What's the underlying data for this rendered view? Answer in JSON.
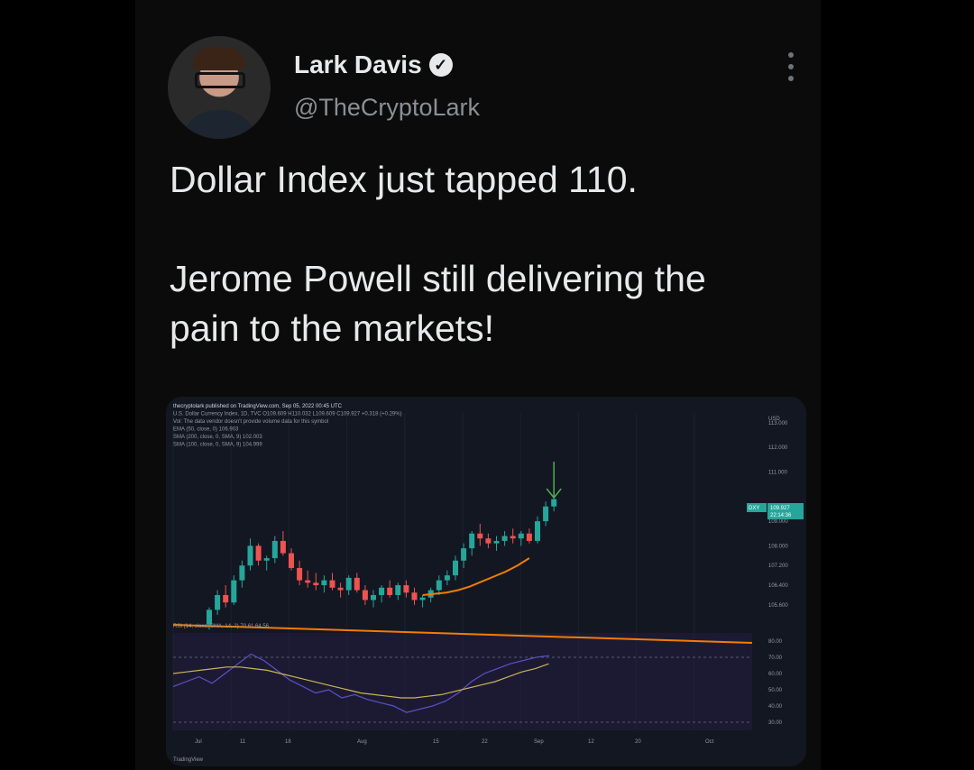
{
  "tweet": {
    "name": "Lark Davis",
    "handle": "@TheCryptoLark",
    "text": "Dollar Index just tapped 110.\n\nJerome Powell still delivering the\npain to the markets!"
  },
  "chart": {
    "publisher_line": "thecryptolark published on TradingView.com, Sep 05, 2022 00:45 UTC",
    "symbol_line": "U.S. Dollar Currency Index, 1D, TVC O109.609 H110.032 L109.609 C109.927 +0.318 (+0.29%)",
    "vol_line": "Vol: The data vendor doesn't provide volume data for this symbol",
    "ema_line": "EMA (50, close, 0) 106.903",
    "sma200_line": "SMA (200, close, 0, SMA, 9) 102.003",
    "sma100_line": "SMA (100, close, 0, SMA, 9) 104.999",
    "rsi_line": "RSI (14, close, SMA, 14, 2) 70.61 64.56",
    "currency": "USD",
    "price_badge_symbol": "DXY",
    "price_badge_value": "109.927",
    "price_badge_time": "22:14:36",
    "footer": "TradingView",
    "price_ticks": [
      "113.000",
      "112.000",
      "111.000",
      "109.000",
      "108.000",
      "107.200",
      "106.400",
      "105.600"
    ],
    "rsi_ticks": [
      "80.00",
      "70.00",
      "60.00",
      "50.00",
      "40.00",
      "30.00"
    ],
    "x_ticks": [
      "Jul",
      "11",
      "18",
      "Aug",
      "15",
      "22",
      "Sep",
      "12",
      "20",
      "Oct"
    ],
    "colors": {
      "up": "#26a69a",
      "down": "#ef5350",
      "ema": "#f57c00",
      "rsi": "#5b52c8",
      "rsi_ma": "#c9b458",
      "arrow": "#4caf50"
    }
  },
  "chart_data": {
    "type": "candlestick",
    "title": "U.S. Dollar Currency Index, 1D, TVC",
    "candles": [
      {
        "o": 104.8,
        "h": 105.5,
        "l": 104.6,
        "c": 105.4
      },
      {
        "o": 105.4,
        "h": 106.2,
        "l": 105.2,
        "c": 106.0
      },
      {
        "o": 106.0,
        "h": 106.4,
        "l": 105.5,
        "c": 105.7
      },
      {
        "o": 105.7,
        "h": 106.8,
        "l": 105.6,
        "c": 106.6
      },
      {
        "o": 106.6,
        "h": 107.4,
        "l": 106.3,
        "c": 107.2
      },
      {
        "o": 107.2,
        "h": 108.3,
        "l": 107.0,
        "c": 108.0
      },
      {
        "o": 108.0,
        "h": 108.1,
        "l": 107.2,
        "c": 107.4
      },
      {
        "o": 107.4,
        "h": 107.6,
        "l": 107.0,
        "c": 107.5
      },
      {
        "o": 107.5,
        "h": 108.4,
        "l": 107.3,
        "c": 108.2
      },
      {
        "o": 108.2,
        "h": 108.6,
        "l": 107.6,
        "c": 107.7
      },
      {
        "o": 107.7,
        "h": 107.9,
        "l": 107.0,
        "c": 107.1
      },
      {
        "o": 107.1,
        "h": 107.4,
        "l": 106.4,
        "c": 106.6
      },
      {
        "o": 106.6,
        "h": 107.0,
        "l": 106.3,
        "c": 106.5
      },
      {
        "o": 106.5,
        "h": 106.9,
        "l": 106.2,
        "c": 106.4
      },
      {
        "o": 106.4,
        "h": 106.8,
        "l": 106.1,
        "c": 106.6
      },
      {
        "o": 106.6,
        "h": 106.9,
        "l": 106.2,
        "c": 106.3
      },
      {
        "o": 106.3,
        "h": 106.5,
        "l": 105.9,
        "c": 106.2
      },
      {
        "o": 106.2,
        "h": 106.8,
        "l": 106.0,
        "c": 106.7
      },
      {
        "o": 106.7,
        "h": 106.9,
        "l": 106.1,
        "c": 106.2
      },
      {
        "o": 106.2,
        "h": 106.4,
        "l": 105.6,
        "c": 105.8
      },
      {
        "o": 105.8,
        "h": 106.2,
        "l": 105.5,
        "c": 106.0
      },
      {
        "o": 106.0,
        "h": 106.4,
        "l": 105.7,
        "c": 106.3
      },
      {
        "o": 106.3,
        "h": 106.6,
        "l": 105.9,
        "c": 106.0
      },
      {
        "o": 106.0,
        "h": 106.5,
        "l": 105.8,
        "c": 106.4
      },
      {
        "o": 106.4,
        "h": 106.6,
        "l": 105.9,
        "c": 106.1
      },
      {
        "o": 106.1,
        "h": 106.3,
        "l": 105.6,
        "c": 105.8
      },
      {
        "o": 105.8,
        "h": 106.0,
        "l": 105.5,
        "c": 105.9
      },
      {
        "o": 105.9,
        "h": 106.3,
        "l": 105.7,
        "c": 106.2
      },
      {
        "o": 106.2,
        "h": 106.8,
        "l": 106.0,
        "c": 106.6
      },
      {
        "o": 106.6,
        "h": 107.0,
        "l": 106.4,
        "c": 106.8
      },
      {
        "o": 106.8,
        "h": 107.6,
        "l": 106.6,
        "c": 107.4
      },
      {
        "o": 107.4,
        "h": 108.1,
        "l": 107.1,
        "c": 107.9
      },
      {
        "o": 107.9,
        "h": 108.6,
        "l": 107.6,
        "c": 108.5
      },
      {
        "o": 108.5,
        "h": 108.9,
        "l": 108.0,
        "c": 108.3
      },
      {
        "o": 108.3,
        "h": 108.5,
        "l": 107.9,
        "c": 108.1
      },
      {
        "o": 108.1,
        "h": 108.4,
        "l": 107.8,
        "c": 108.2
      },
      {
        "o": 108.2,
        "h": 108.6,
        "l": 108.0,
        "c": 108.4
      },
      {
        "o": 108.4,
        "h": 108.7,
        "l": 108.1,
        "c": 108.3
      },
      {
        "o": 108.3,
        "h": 108.6,
        "l": 108.0,
        "c": 108.5
      },
      {
        "o": 108.5,
        "h": 108.7,
        "l": 108.1,
        "c": 108.2
      },
      {
        "o": 108.2,
        "h": 109.2,
        "l": 108.1,
        "c": 109.0
      },
      {
        "o": 109.0,
        "h": 109.8,
        "l": 108.8,
        "c": 109.6
      },
      {
        "o": 109.6,
        "h": 110.0,
        "l": 109.4,
        "c": 109.9
      }
    ],
    "ema50": [
      106.0,
      106.05,
      106.1,
      106.2,
      106.35,
      106.55,
      106.75,
      106.95,
      107.2,
      107.5
    ],
    "rsi": [
      52,
      55,
      58,
      54,
      60,
      66,
      72,
      68,
      62,
      56,
      52,
      48,
      50,
      45,
      47,
      44,
      42,
      40,
      36,
      38,
      40,
      43,
      48,
      55,
      60,
      63,
      66,
      68,
      70,
      71
    ],
    "rsi_ma": [
      60,
      61,
      62,
      63,
      64,
      64,
      63,
      62,
      60,
      58,
      56,
      54,
      52,
      50,
      48,
      47,
      46,
      45,
      45,
      46,
      47,
      49,
      51,
      53,
      55,
      58,
      61,
      63,
      66
    ],
    "ylabel": "USD",
    "ylim": [
      104.9,
      113.4
    ],
    "rsi_ylim": [
      25,
      85
    ]
  }
}
